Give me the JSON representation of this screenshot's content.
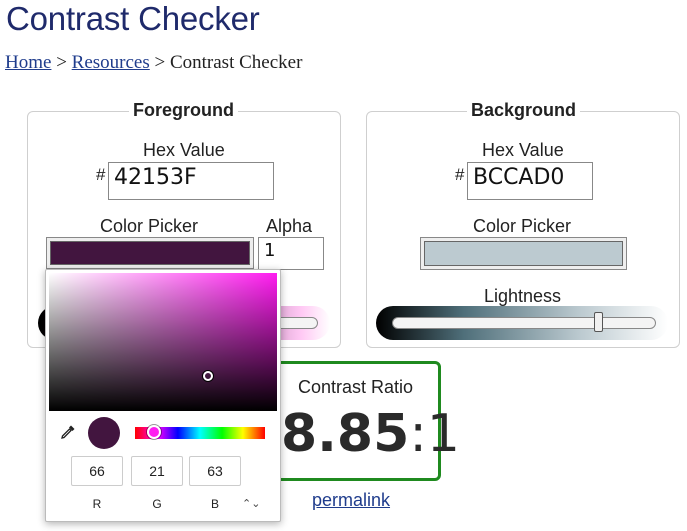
{
  "page": {
    "title": "Contrast Checker",
    "breadcrumb": {
      "home": "Home",
      "resources": "Resources",
      "sep": ">",
      "current": "Contrast Checker"
    }
  },
  "foreground": {
    "heading": "Foreground",
    "hex_label": "Hex Value",
    "hash": "#",
    "hex_value": "42153F",
    "picker_label": "Color Picker",
    "alpha_label": "Alpha",
    "alpha_value": "1",
    "swatch_color": "#42153F"
  },
  "background": {
    "heading": "Background",
    "hex_label": "Hex Value",
    "hash": "#",
    "hex_value": "BCCAD0",
    "picker_label": "Color Picker",
    "lightness_label": "Lightness",
    "swatch_color": "#BCCAD0",
    "lightness_level": 0.78
  },
  "contrast": {
    "label": "Contrast Ratio",
    "value": "8.85",
    "suffix": ":1",
    "permalink": "permalink"
  },
  "color_picker_popup": {
    "r": "66",
    "g": "21",
    "b": "63",
    "r_label": "R",
    "g_label": "G",
    "b_label": "B",
    "mode_toggle": "⌃⌄",
    "hue_color": "#ff1cf0",
    "preview_color": "#42153F"
  },
  "colors": {
    "title": "#1f2a6b",
    "link": "#1f3c8c",
    "ratio_border": "#1f8a1f"
  }
}
